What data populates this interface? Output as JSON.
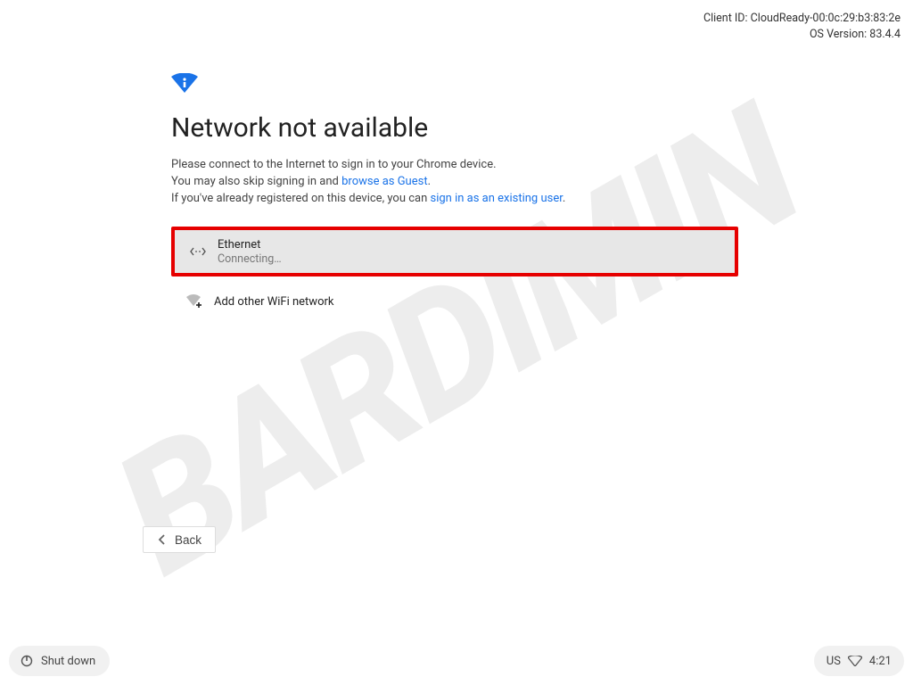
{
  "top_info": {
    "client_id_label": "Client ID:",
    "client_id": "CloudReady-00:0c:29:b3:83:2e",
    "os_version_label": "OS Version:",
    "os_version": "83.4.4"
  },
  "heading": "Network not available",
  "description": {
    "line1": "Please connect to the Internet to sign in to your Chrome device.",
    "line2_prefix": "You may also skip signing in and ",
    "line2_link": "browse as Guest",
    "line3_prefix": "If you've already registered on this device, you can ",
    "line3_link": "sign in as an existing user"
  },
  "networks": {
    "ethernet": {
      "title": "Ethernet",
      "status": "Connecting…"
    },
    "add_wifi": {
      "title": "Add other WiFi network"
    }
  },
  "back_label": "Back",
  "shutdown_label": "Shut down",
  "tray": {
    "keyboard": "US",
    "time": "4:21"
  },
  "watermark": "BARDIMIN"
}
